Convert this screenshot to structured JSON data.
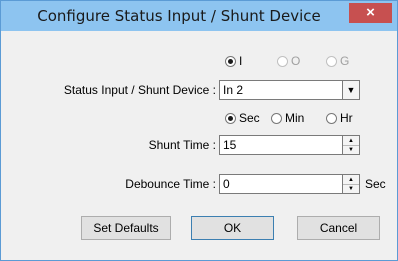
{
  "window": {
    "title": "Configure Status Input / Shunt Device",
    "close_glyph": "×"
  },
  "type_radios": [
    {
      "label": "I",
      "checked": true,
      "disabled": false
    },
    {
      "label": "O",
      "checked": false,
      "disabled": true
    },
    {
      "label": "G",
      "checked": false,
      "disabled": true
    }
  ],
  "device": {
    "label": "Status Input / Shunt Device :",
    "value": "In 2"
  },
  "unit_radios": [
    {
      "label": "Sec",
      "checked": true
    },
    {
      "label": "Min",
      "checked": false
    },
    {
      "label": "Hr",
      "checked": false
    }
  ],
  "shunt": {
    "label": "Shunt Time :",
    "value": "15"
  },
  "debounce": {
    "label": "Debounce Time :",
    "value": "0",
    "unit": "Sec"
  },
  "buttons": {
    "set_defaults": "Set Defaults",
    "ok": "OK",
    "cancel": "Cancel"
  },
  "colors": {
    "titlebar": "#8dc4f0",
    "close": "#c75050",
    "border": "#5b9bd5"
  }
}
